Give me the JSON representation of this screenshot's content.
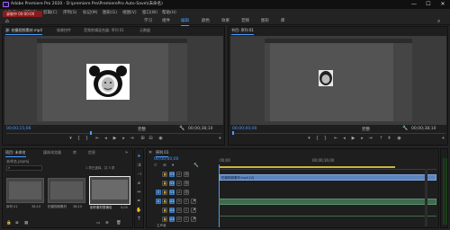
{
  "window": {
    "title": "Adobe Premiere Pro 2020 - D:\\premiere Pro\\PremierePro Auto-Save\\(未命名)",
    "minimize": "—",
    "maximize": "☐",
    "close": "✕"
  },
  "recording_badge": "录制中 00:00:00",
  "menu": [
    "文件(F)",
    "编辑(E)",
    "剪辑(C)",
    "序列(S)",
    "标记(M)",
    "图形(G)",
    "视图(V)",
    "窗口(W)",
    "帮助(H)"
  ],
  "workspaces": [
    "学习",
    "组件",
    "编辑",
    "颜色",
    "效果",
    "音频",
    "图形",
    "库"
  ],
  "workspaces_active": 2,
  "source_monitor": {
    "tabs": [
      "源: 拍摄视频素材.mp4",
      "效果控件",
      "音频剪辑混合器: 序列 01",
      "元数据"
    ],
    "timecode": "00;00;15;06",
    "fit": "完整",
    "duration": "00;00;38;10"
  },
  "program_monitor": {
    "tabs": [
      "节目: 序列 01"
    ],
    "timecode": "00;00;00;00",
    "fit": "完整",
    "duration": "00;00;38;10"
  },
  "transport_icons": [
    "marker-icon",
    "in-point-icon",
    "out-point-icon",
    "go-to-in-icon",
    "step-back-icon",
    "play-icon",
    "step-forward-icon",
    "go-to-out-icon",
    "insert-icon",
    "overwrite-icon",
    "export-frame-icon",
    "button-editor-icon"
  ],
  "project_panel": {
    "tabs": [
      "项目: 未命名",
      "媒体浏览器",
      "库",
      "信息"
    ],
    "project_file": "未命名.prproj",
    "selection": "1 项已选择，共 3 项",
    "items": [
      {
        "name": "序列 01",
        "duration": "38;10"
      },
      {
        "name": "拍摄视频素材",
        "duration": "38;10"
      },
      {
        "name": "制作素材表情包",
        "duration": "5;00"
      }
    ]
  },
  "timeline": {
    "tab": "序列 01",
    "timecode": "00;00;00;00",
    "ruler": [
      ":00;00",
      "00;00;16;00"
    ],
    "video_tracks": [
      "V3",
      "V2",
      "V1"
    ],
    "audio_tracks": [
      "A1",
      "A2",
      "A3"
    ],
    "clip_label": "拍摄视频素材.mp4 [V]",
    "master_label": "主声道"
  },
  "colors": {
    "accent": "#4b9cff",
    "clip_video": "#5b86c2",
    "recording": "#8b1a1a",
    "panel_bg": "#1e1e1e"
  }
}
